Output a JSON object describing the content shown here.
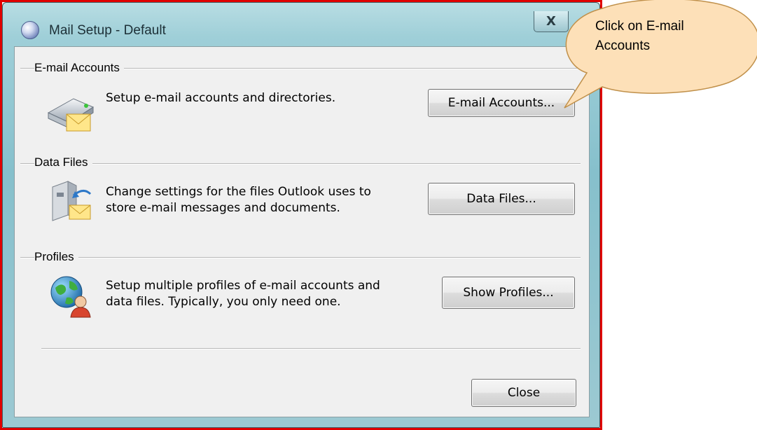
{
  "window": {
    "title": "Mail Setup - Default",
    "close_glyph": "X"
  },
  "sections": [
    {
      "heading": "E-mail Accounts",
      "description": "Setup e-mail accounts and directories.",
      "button": "E-mail Accounts...",
      "icon": "email-accounts-icon"
    },
    {
      "heading": "Data Files",
      "description_line1": "Change settings for the files Outlook uses to",
      "description_line2": "store e-mail messages and documents.",
      "button": "Data Files...",
      "icon": "data-files-icon"
    },
    {
      "heading": "Profiles",
      "description_line1": "Setup multiple profiles of e-mail accounts and",
      "description_line2": "data files. Typically, you only need one.",
      "button": "Show Profiles...",
      "icon": "profiles-icon"
    }
  ],
  "footer": {
    "close_label": "Close"
  },
  "callout": {
    "text_line1": "Click on E-mail",
    "text_line2": "Accounts"
  },
  "colors": {
    "highlight_border": "#e00000",
    "callout_fill": "#fde0b8",
    "callout_border": "#c0904a"
  }
}
